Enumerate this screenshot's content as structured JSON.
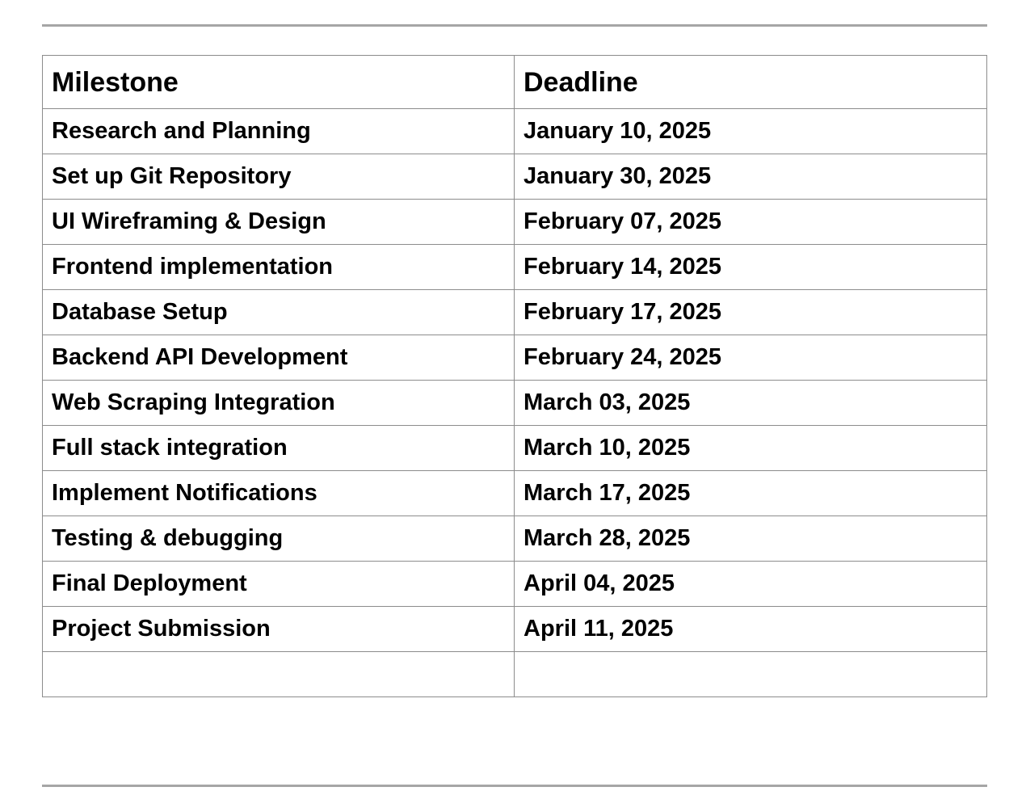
{
  "table": {
    "headers": {
      "milestone": "Milestone",
      "deadline": "Deadline"
    },
    "rows": [
      {
        "milestone": "Research and Planning",
        "deadline": "January 10, 2025"
      },
      {
        "milestone": "Set up Git Repository",
        "deadline": "January 30, 2025"
      },
      {
        "milestone": "UI Wireframing & Design",
        "deadline": "February 07, 2025"
      },
      {
        "milestone": "Frontend implementation",
        "deadline": "February 14, 2025"
      },
      {
        "milestone": "Database Setup",
        "deadline": "February 17, 2025"
      },
      {
        "milestone": "Backend API Development",
        "deadline": "February 24, 2025"
      },
      {
        "milestone": "Web Scraping Integration",
        "deadline": "March 03, 2025"
      },
      {
        "milestone": "Full stack integration",
        "deadline": "March 10, 2025"
      },
      {
        "milestone": "Implement Notifications",
        "deadline": "March 17, 2025"
      },
      {
        "milestone": "Testing & debugging",
        "deadline": "March 28, 2025"
      },
      {
        "milestone": "Final Deployment",
        "deadline": "April 04, 2025"
      },
      {
        "milestone": "Project Submission",
        "deadline": "April 11, 2025"
      },
      {
        "milestone": "",
        "deadline": ""
      }
    ]
  }
}
